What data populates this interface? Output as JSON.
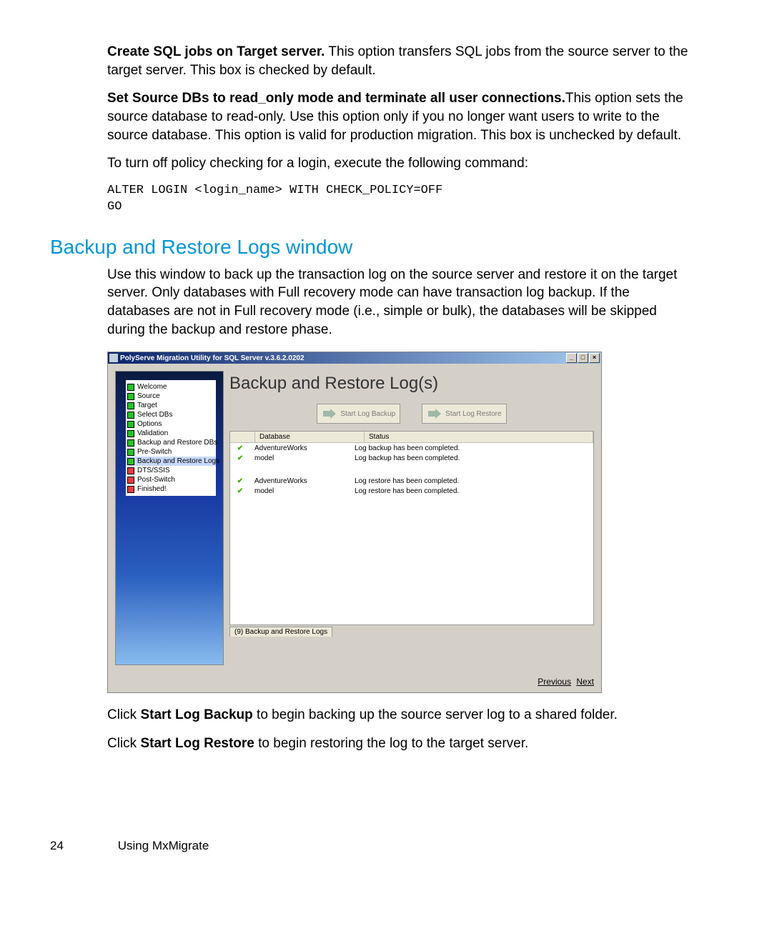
{
  "paragraphs": {
    "p1_bold": "Create SQL jobs on Target server.",
    "p1_rest": " This option transfers SQL jobs from the source server to the target server. This box is checked by default.",
    "p2_bold": "Set Source DBs to read_only mode and terminate all user connections.",
    "p2_rest": "This option sets the source database to read-only. Use this option only if you no longer want users to write to the source database. This option is valid for production migration. This box is unchecked by default.",
    "p3": "To turn off policy checking for a login, execute the following command:",
    "code": "ALTER LOGIN <login_name> WITH CHECK_POLICY=OFF\nGO",
    "h2": "Backup and Restore Logs window",
    "p4": "Use this window to back up the transaction log on the source server and restore it on the target server. Only databases with Full recovery mode can have transaction log backup. If the databases are not in Full recovery mode (i.e., simple or bulk), the databases will be skipped during the backup and restore phase.",
    "p5a": "Click ",
    "p5b": "Start Log Backup",
    "p5c": " to begin backing up the source server log to a shared folder.",
    "p6a": "Click ",
    "p6b": "Start Log Restore",
    "p6c": " to begin restoring the log to the target server."
  },
  "footer": {
    "page": "24",
    "label": "Using MxMigrate"
  },
  "window": {
    "title": "PolyServe Migration Utility for SQL Server v.3.6.2.0202",
    "nav": [
      {
        "c": "g",
        "t": "Welcome"
      },
      {
        "c": "g",
        "t": "Source"
      },
      {
        "c": "g",
        "t": "Target"
      },
      {
        "c": "g",
        "t": "Select DBs"
      },
      {
        "c": "g",
        "t": "Options"
      },
      {
        "c": "g",
        "t": "Validation"
      },
      {
        "c": "g",
        "t": "Backup and Restore DBs"
      },
      {
        "c": "g",
        "t": "Pre-Switch"
      },
      {
        "c": "g",
        "t": "Backup and Restore Logs",
        "sel": true
      },
      {
        "c": "r",
        "t": "DTS/SSIS"
      },
      {
        "c": "r",
        "t": "Post-Switch"
      },
      {
        "c": "r",
        "t": "Finished!"
      }
    ],
    "main_title": "Backup and Restore Log(s)",
    "btn_backup": "Start Log Backup",
    "btn_restore": "Start Log Restore",
    "columns": {
      "db": "Database",
      "status": "Status"
    },
    "rows": [
      {
        "db": "AdventureWorks",
        "st": "Log backup has been completed."
      },
      {
        "db": "model",
        "st": "Log backup has been completed."
      },
      {
        "gap": true
      },
      {
        "db": "AdventureWorks",
        "st": "Log restore has been completed."
      },
      {
        "db": "model",
        "st": "Log restore has been completed."
      }
    ],
    "tab": "(9) Backup and Restore Logs",
    "prev": "Previous",
    "next": "Next"
  }
}
